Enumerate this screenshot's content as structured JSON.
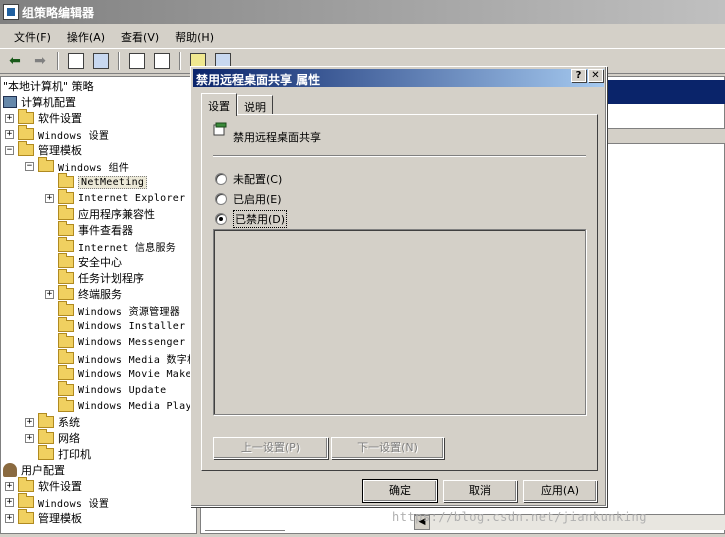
{
  "main_window": {
    "title": "组策略编辑器"
  },
  "menu": [
    "文件(F)",
    "操作(A)",
    "查看(V)",
    "帮助(H)"
  ],
  "tree": {
    "root": "\"本地计算机\" 策略",
    "computer_config": "计算机配置",
    "software_settings_1": "软件设置",
    "windows_settings_1": "Windows 设置",
    "admin_templates_1": "管理模板",
    "windows_components": "Windows 组件",
    "netmeeting": "NetMeeting",
    "ie": "Internet Explorer",
    "app_compat": "应用程序兼容性",
    "event_viewer": "事件查看器",
    "iis": "Internet 信息服务",
    "security_center": "安全中心",
    "task_scheduler": "任务计划程序",
    "terminal_services": "终端服务",
    "explorer": "Windows 资源管理器",
    "installer": "Windows Installer",
    "messenger": "Windows Messenger",
    "media_drm": "Windows Media 数字权",
    "movie_maker": "Windows Movie Maker",
    "update": "Windows Update",
    "media_player": "Windows Media Playe",
    "system": "系统",
    "network": "网络",
    "printers": "打印机",
    "user_config": "用户配置",
    "software_settings_2": "软件设置",
    "windows_settings_2": "Windows 设置",
    "admin_templates_2": "管理模板"
  },
  "dialog": {
    "title": "禁用远程桌面共享 属性",
    "help_btn": "?",
    "close_btn": "✕",
    "tabs": [
      "设置",
      "说明"
    ],
    "policy_name": "禁用远程桌面共享",
    "options": [
      "未配置(C)",
      "已启用(E)",
      "已禁用(D)"
    ],
    "selected_option": 2,
    "prev_setting": "上一设置(P)",
    "next_setting": "下一设置(N)",
    "ok": "确定",
    "cancel": "取消",
    "apply": "应用(A)"
  },
  "watermark": "https://blog.csdn.net/jiankunking"
}
